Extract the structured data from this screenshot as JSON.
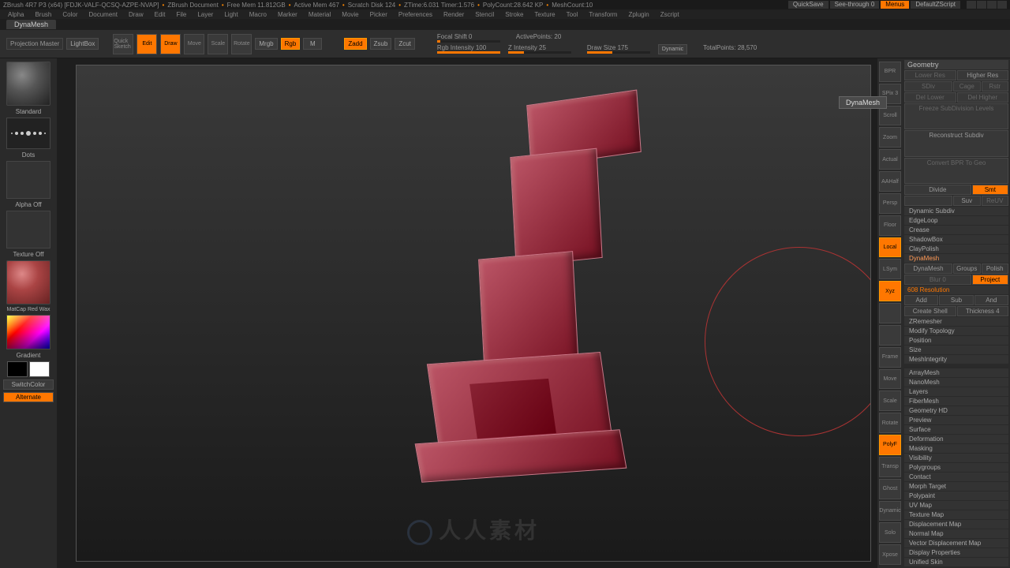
{
  "title": {
    "app": "ZBrush 4R7 P3 (x64) [FDJK-VALF-QCSQ-AZPE-NVAP]",
    "doc": "ZBrush Document",
    "free_mem": "Free Mem 11.812GB",
    "active_mem": "Active Mem 467",
    "scratch": "Scratch Disk 124",
    "ztime": "ZTime:6.031 Timer:1.576",
    "polycount": "PolyCount:28.642 KP",
    "meshcount": "MeshCount:10",
    "quicksave": "QuickSave",
    "seethrough": "See-through  0",
    "menus": "Menus",
    "script": "DefaultZScript"
  },
  "menu": [
    "Alpha",
    "Brush",
    "Color",
    "Document",
    "Draw",
    "Edit",
    "File",
    "Layer",
    "Light",
    "Macro",
    "Marker",
    "Material",
    "Movie",
    "Picker",
    "Preferences",
    "Render",
    "Stencil",
    "Stroke",
    "Texture",
    "Tool",
    "Transform",
    "Zplugin",
    "Zscript"
  ],
  "tab": "DynaMesh",
  "toolbar": {
    "projection": "Projection\nMaster",
    "lightbox": "LightBox",
    "quicksketch": "Quick\nSketch",
    "edit": "Edit",
    "draw": "Draw",
    "move": "Move",
    "scale": "Scale",
    "rotate": "Rotate",
    "mrgb": "Mrgb",
    "rgb": "Rgb",
    "m": "M",
    "zadd": "Zadd",
    "zsub": "Zsub",
    "zcut": "Zcut",
    "rgb_int": "Rgb Intensity 100",
    "z_int": "Z Intensity 25",
    "focal": "Focal Shift 0",
    "drawsize": "Draw Size 175",
    "dynamic": "Dynamic",
    "active_pts": "ActivePoints: 20",
    "total_pts": "TotalPoints: 28,570"
  },
  "left": {
    "brush": "Standard",
    "stroke": "Dots",
    "alpha": "Alpha Off",
    "texture": "Texture Off",
    "material": "MatCap Red Wax",
    "gradient": "Gradient",
    "switch": "SwitchColor",
    "alternate": "Alternate"
  },
  "dock": [
    "BPR",
    "SPix 3",
    "Scroll",
    "Zoom",
    "Actual",
    "AAHalf",
    "Persp",
    "Floor",
    "Local",
    "LSym",
    "Xyz",
    "",
    "",
    "Frame",
    "Move",
    "Scale",
    "Rotate",
    "PolyF",
    "Transp",
    "Ghost",
    "Dynamic",
    "Solo",
    "Xpose"
  ],
  "tooltip": "DynaMesh",
  "panel": {
    "header": "Geometry",
    "lowres": "Lower Res",
    "highres": "Higher Res",
    "sdiv": "SDiv",
    "cage": "Cage",
    "rstr": "Rstr",
    "dellower": "Del Lower",
    "delhigher": "Del Higher",
    "freeze": "Freeze SubDivision Levels",
    "reconstruct": "Reconstruct Subdiv",
    "convert": "Convert BPR To Geo",
    "divide": "Divide",
    "smt": "Smt",
    "suv": "Suv",
    "reuv": "ReUV",
    "items": [
      "Dynamic Subdiv",
      "EdgeLoop",
      "Crease",
      "ShadowBox",
      "ClayPolish",
      "DynaMesh"
    ],
    "dynamesh": "DynaMesh",
    "groups": "Groups",
    "polish": "Polish",
    "blur": "Blur 0",
    "project": "Project",
    "resolution": "608 Resolution",
    "add": "Add",
    "sub": "Sub",
    "and": "And",
    "createshell": "Create Shell",
    "thickness": "Thickness 4",
    "items2": [
      "ZRemesher",
      "Modify Topology",
      "Position",
      "Size",
      "MeshIntegrity"
    ],
    "items3": [
      "ArrayMesh",
      "NanoMesh",
      "Layers",
      "FiberMesh",
      "Geometry HD",
      "Preview",
      "Surface",
      "Deformation",
      "Masking",
      "Visibility",
      "Polygroups",
      "Contact",
      "Morph Target",
      "Polypaint",
      "UV Map",
      "Texture Map",
      "Displacement Map",
      "Normal Map",
      "Vector Displacement Map",
      "Display Properties",
      "Unified Skin"
    ]
  },
  "watermark": "人人素材"
}
